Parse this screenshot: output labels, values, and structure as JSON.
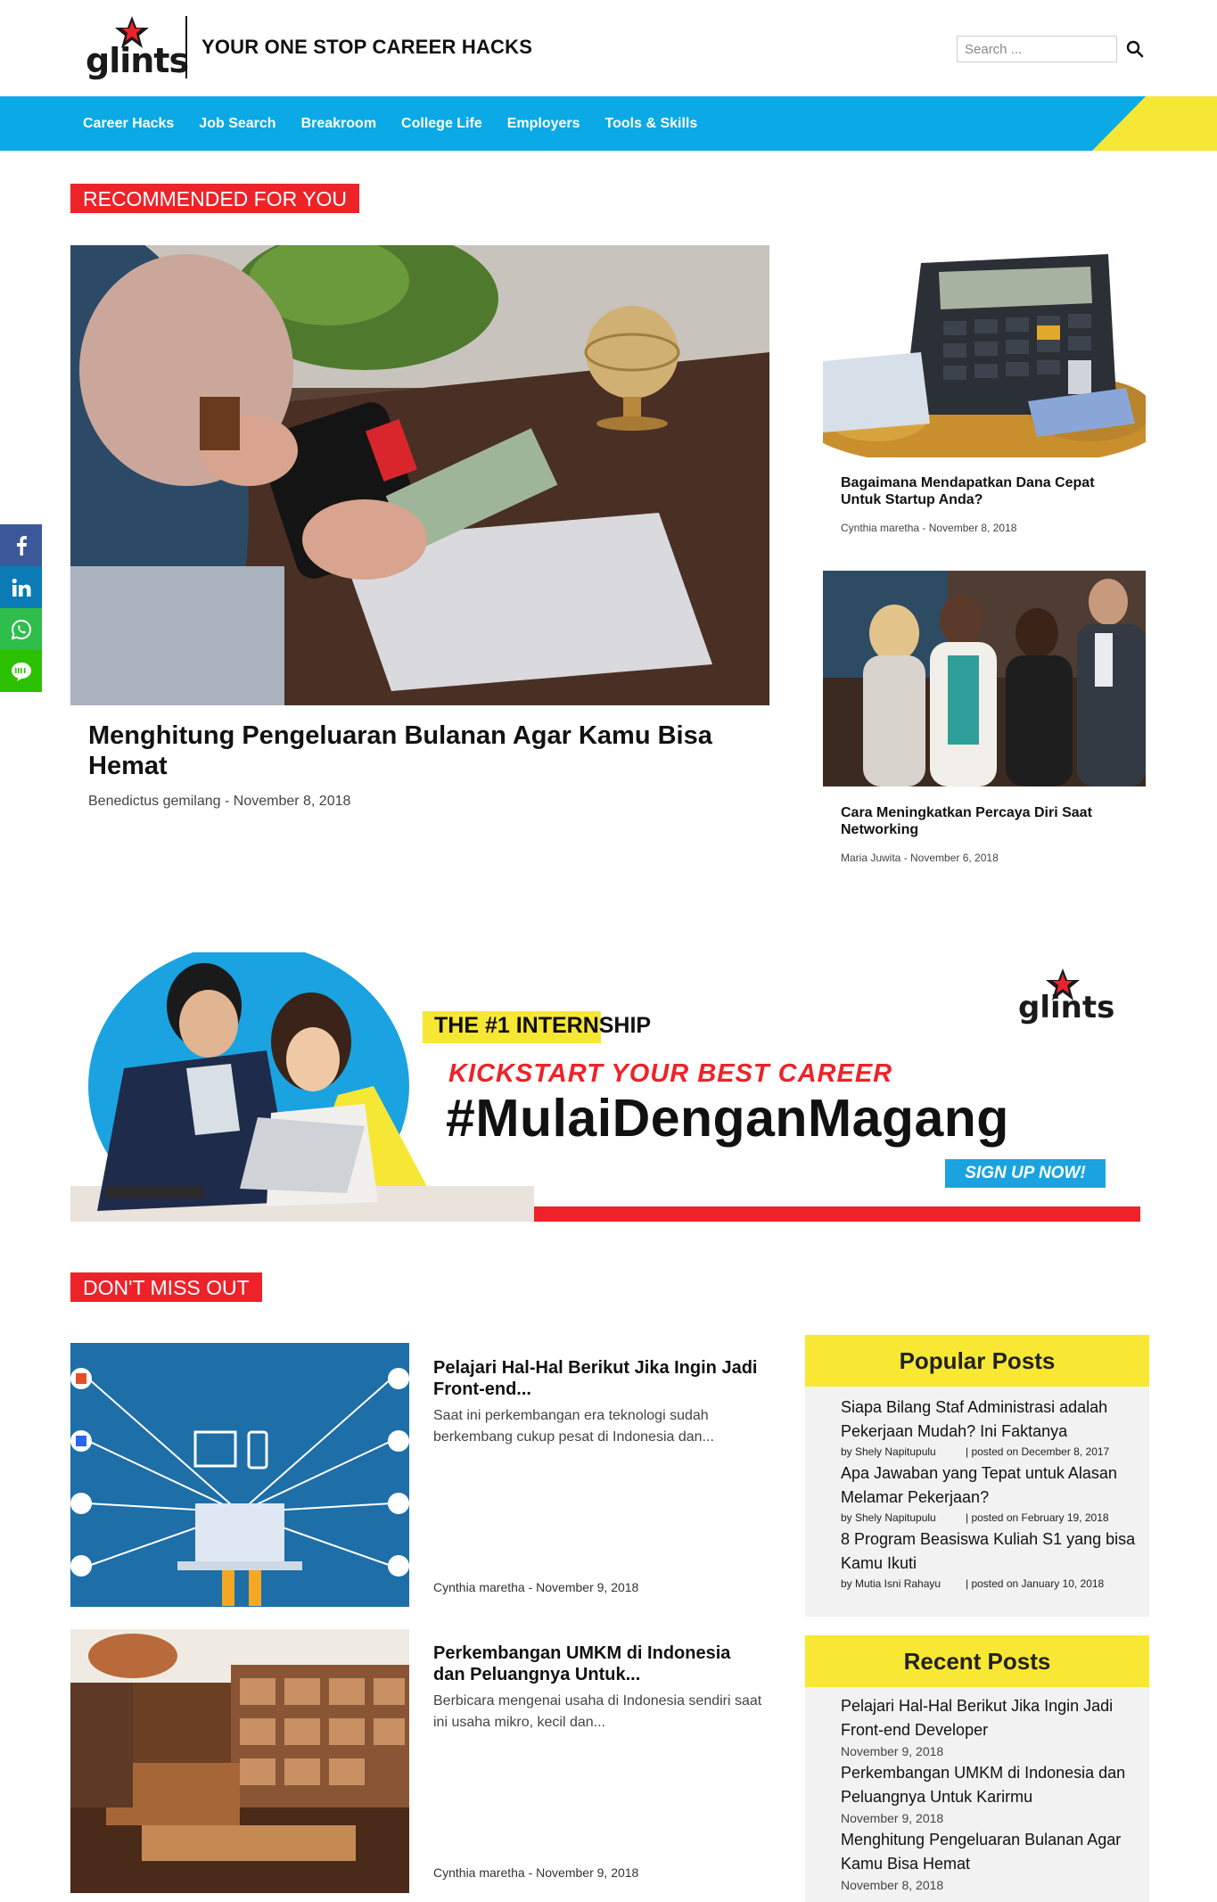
{
  "header": {
    "logo_text": "glints",
    "tagline": "YOUR ONE STOP CAREER HACKS",
    "search_placeholder": "Search ..."
  },
  "nav": {
    "items": [
      "Career Hacks",
      "Job Search",
      "Breakroom",
      "College Life",
      "Employers",
      "Tools & Skills"
    ]
  },
  "sections": {
    "recommended": "RECOMMENDED FOR YOU",
    "dont_miss": "DON'T MISS OUT"
  },
  "featured": {
    "title": "Menghitung Pengeluaran Bulanan Agar Kamu Bisa Hemat",
    "meta": "Benedictus gemilang - November 8, 2018"
  },
  "side_posts": [
    {
      "title": "Bagaimana Mendapatkan Dana Cepat Untuk Startup Anda?",
      "meta": "Cynthia maretha - November 8, 2018"
    },
    {
      "title": "Cara Meningkatkan Percaya Diri Saat Networking",
      "meta": "Maria Juwita - November 6, 2018"
    }
  ],
  "banner": {
    "badge": "THE #1 INTERNSHIP",
    "kicker": "KICKSTART YOUR BEST CAREER",
    "headline": "#MulaiDenganMagang",
    "cta": "SIGN UP NOW!",
    "logo": "glints"
  },
  "list_posts": [
    {
      "title": "Pelajari Hal-Hal Berikut Jika Ingin Jadi Front-end...",
      "excerpt": "Saat ini perkembangan era teknologi sudah berkembang cukup pesat di Indonesia dan...",
      "meta": "Cynthia maretha - November 9, 2018"
    },
    {
      "title": "Perkembangan UMKM di Indonesia dan Peluangnya Untuk...",
      "excerpt": "Berbicara mengenai usaha di Indonesia sendiri saat ini usaha mikro, kecil dan...",
      "meta": "Cynthia maretha - November 9, 2018"
    }
  ],
  "popular": {
    "heading": "Popular Posts",
    "items": [
      {
        "title": "Siapa Bilang Staf Administrasi adalah Pekerjaan Mudah? Ini Faktanya",
        "author": "by Shely Napitupulu",
        "posted": "| posted on December 8, 2017"
      },
      {
        "title": "Apa Jawaban yang Tepat untuk Alasan Melamar Pekerjaan?",
        "author": "by Shely Napitupulu",
        "posted": "| posted on February 19, 2018"
      },
      {
        "title": "8 Program Beasiswa Kuliah S1 yang bisa Kamu Ikuti",
        "author": "by Mutia Isni Rahayu",
        "posted": "| posted on January 10, 2018"
      }
    ]
  },
  "recent": {
    "heading": "Recent Posts",
    "items": [
      {
        "title": "Pelajari Hal-Hal Berikut Jika Ingin Jadi Front-end Developer",
        "date": "November 9, 2018"
      },
      {
        "title": "Perkembangan UMKM di Indonesia dan Peluangnya Untuk Karirmu",
        "date": "November 9, 2018"
      },
      {
        "title": "Menghitung Pengeluaran Bulanan Agar Kamu Bisa Hemat",
        "date": "November 8, 2018"
      }
    ]
  },
  "colors": {
    "nav_blue": "#0ba9e6",
    "accent_red": "#ed2329",
    "accent_yellow": "#f9e833"
  }
}
